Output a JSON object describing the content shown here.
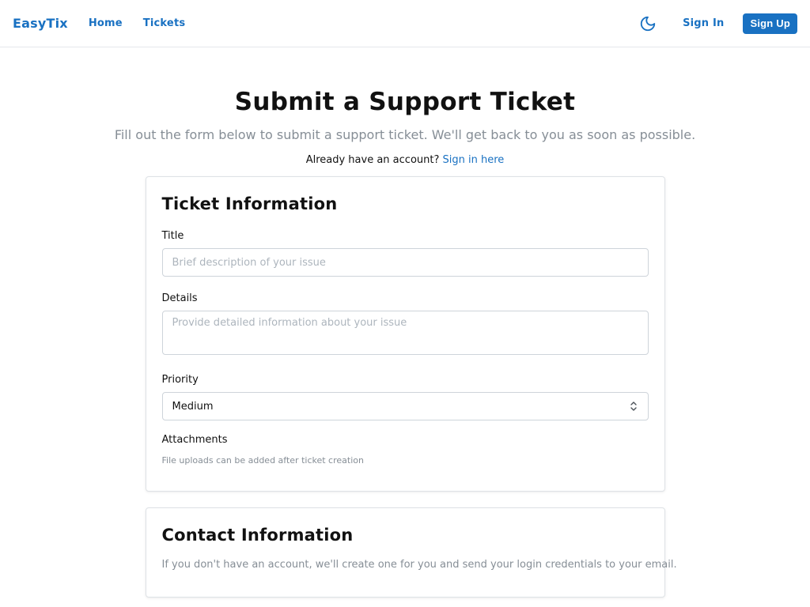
{
  "nav": {
    "brand": "EasyTix",
    "links": [
      "Home",
      "Tickets"
    ],
    "theme_icon": "moon-icon",
    "sign_in": "Sign In",
    "sign_up": "Sign Up"
  },
  "header": {
    "title": "Submit a Support Ticket",
    "subtitle": "Fill out the form below to submit a support ticket. We'll get back to you as soon as possible.",
    "account_prompt": "Already have an account?",
    "account_link": "Sign in here"
  },
  "ticket_card": {
    "title": "Ticket Information",
    "title_label": "Title",
    "title_placeholder": "Brief description of your issue",
    "details_label": "Details",
    "details_placeholder": "Provide detailed information about your issue",
    "priority_label": "Priority",
    "priority_value": "Medium",
    "attachments_label": "Attachments",
    "attachments_hint": "File uploads can be added after ticket creation"
  },
  "contact_card": {
    "title": "Contact Information",
    "description": "If you don't have an account, we'll create one for you and send your login credentials to your email."
  },
  "colors": {
    "accent": "#1971c2",
    "muted_text": "#868e96",
    "border": "#ced4da"
  }
}
